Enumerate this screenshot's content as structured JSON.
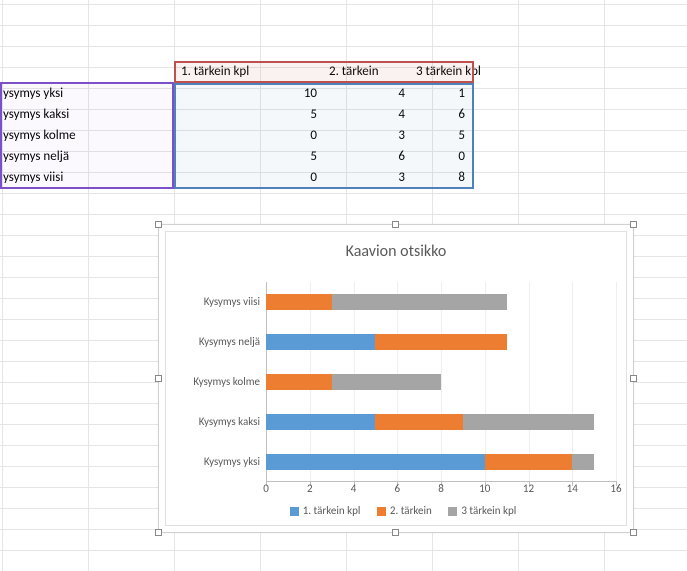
{
  "table": {
    "headers": [
      "1. tärkein kpl",
      "2. tärkein",
      "3 tärkein kpl"
    ],
    "rows": [
      {
        "label": "ysymys yksi",
        "v": [
          10,
          4,
          1
        ]
      },
      {
        "label": "ysymys kaksi",
        "v": [
          5,
          4,
          6
        ]
      },
      {
        "label": "ysymys kolme",
        "v": [
          0,
          3,
          5
        ]
      },
      {
        "label": "ysymys neljä",
        "v": [
          5,
          6,
          0
        ]
      },
      {
        "label": "ysymys viisi",
        "v": [
          0,
          3,
          8
        ]
      }
    ]
  },
  "chart_data": {
    "type": "bar",
    "orientation": "horizontal-stacked",
    "title": "Kaavion otsikko",
    "xlabel": "",
    "ylabel": "",
    "xlim": [
      0,
      16
    ],
    "xticks": [
      0,
      2,
      4,
      6,
      8,
      10,
      12,
      14,
      16
    ],
    "categories": [
      "Kysymys yksi",
      "Kysymys kaksi",
      "Kysymys kolme",
      "Kysymys neljä",
      "Kysymys viisi"
    ],
    "series": [
      {
        "name": "1. tärkein kpl",
        "color": "#5b9bd5",
        "values": [
          10,
          5,
          0,
          5,
          0
        ]
      },
      {
        "name": "2. tärkein",
        "color": "#ed7d31",
        "values": [
          4,
          4,
          3,
          6,
          3
        ]
      },
      {
        "name": "3 tärkein kpl",
        "color": "#a5a5a5",
        "values": [
          1,
          6,
          5,
          0,
          8
        ]
      }
    ],
    "legend_position": "bottom"
  }
}
